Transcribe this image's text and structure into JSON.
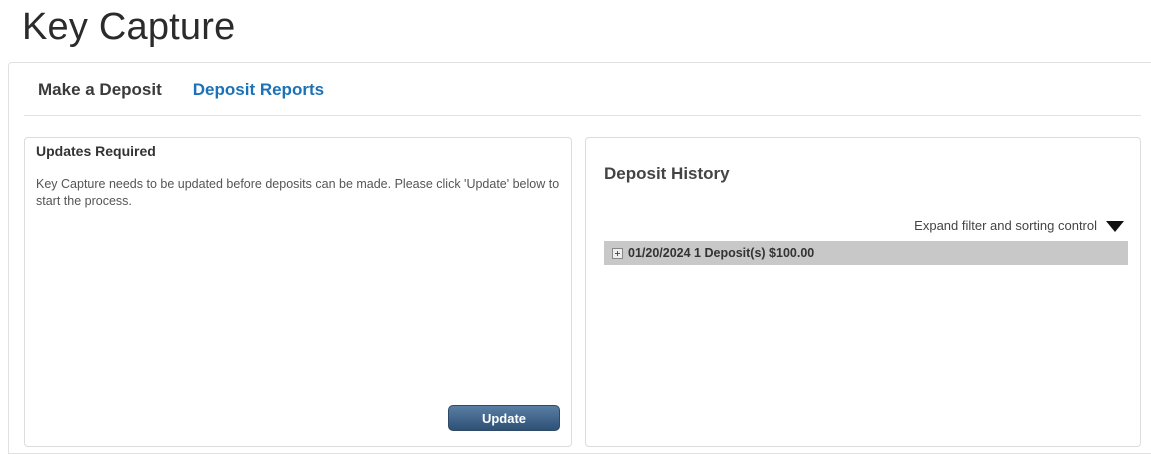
{
  "app": {
    "title": "Key Capture"
  },
  "tabs": [
    {
      "label": "Make a Deposit",
      "active": false
    },
    {
      "label": "Deposit Reports",
      "active": true
    }
  ],
  "updates_panel": {
    "title": "Updates Required",
    "message": "Key Capture needs to be updated before deposits can be made. Please click 'Update' below to start the process.",
    "button_label": "Update"
  },
  "history_panel": {
    "title": "Deposit History",
    "filter_label": "Expand filter and sorting control",
    "filter_icon": "triangle-down-icon",
    "rows": [
      {
        "text": "01/20/2024 1 Deposit(s) $100.00",
        "icon": "expand-icon"
      }
    ]
  },
  "colors": {
    "accent_link": "#1c72b8",
    "button_top": "#5b7ea4",
    "button_bottom": "#2d5075",
    "row_background": "#c8c8c8"
  }
}
